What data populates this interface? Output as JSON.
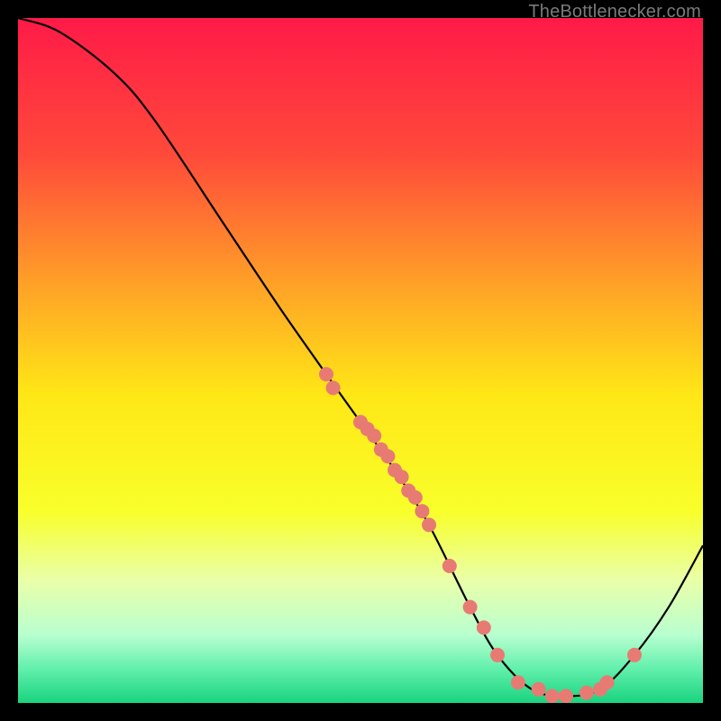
{
  "watermark": "TheBottlenecker.com",
  "chart_data": {
    "type": "line",
    "title": "",
    "xlabel": "",
    "ylabel": "",
    "xlim": [
      0,
      100
    ],
    "ylim": [
      0,
      100
    ],
    "background_gradient": {
      "direction": "vertical",
      "stops": [
        {
          "pos": 0.0,
          "color": "#ff1a48"
        },
        {
          "pos": 0.2,
          "color": "#ff4a3a"
        },
        {
          "pos": 0.4,
          "color": "#ffa626"
        },
        {
          "pos": 0.55,
          "color": "#ffe716"
        },
        {
          "pos": 0.72,
          "color": "#f8ff2a"
        },
        {
          "pos": 0.82,
          "color": "#eaffa8"
        },
        {
          "pos": 0.9,
          "color": "#b9ffd0"
        },
        {
          "pos": 0.95,
          "color": "#62f0ac"
        },
        {
          "pos": 1.0,
          "color": "#19d37f"
        }
      ]
    },
    "curve": [
      {
        "x": 0,
        "y": 100
      },
      {
        "x": 6,
        "y": 98
      },
      {
        "x": 14,
        "y": 92
      },
      {
        "x": 20,
        "y": 85
      },
      {
        "x": 30,
        "y": 70
      },
      {
        "x": 38,
        "y": 58
      },
      {
        "x": 45,
        "y": 48
      },
      {
        "x": 50,
        "y": 41
      },
      {
        "x": 55,
        "y": 34
      },
      {
        "x": 60,
        "y": 26
      },
      {
        "x": 66,
        "y": 14
      },
      {
        "x": 70,
        "y": 7
      },
      {
        "x": 75,
        "y": 2
      },
      {
        "x": 80,
        "y": 1
      },
      {
        "x": 85,
        "y": 2
      },
      {
        "x": 90,
        "y": 7
      },
      {
        "x": 95,
        "y": 14
      },
      {
        "x": 100,
        "y": 23
      }
    ],
    "points": [
      {
        "x": 45,
        "y": 48
      },
      {
        "x": 46,
        "y": 46
      },
      {
        "x": 50,
        "y": 41
      },
      {
        "x": 51,
        "y": 40
      },
      {
        "x": 52,
        "y": 39
      },
      {
        "x": 53,
        "y": 37
      },
      {
        "x": 54,
        "y": 36
      },
      {
        "x": 55,
        "y": 34
      },
      {
        "x": 56,
        "y": 33
      },
      {
        "x": 57,
        "y": 31
      },
      {
        "x": 58,
        "y": 30
      },
      {
        "x": 59,
        "y": 28
      },
      {
        "x": 60,
        "y": 26
      },
      {
        "x": 63,
        "y": 20
      },
      {
        "x": 66,
        "y": 14
      },
      {
        "x": 68,
        "y": 11
      },
      {
        "x": 70,
        "y": 7
      },
      {
        "x": 73,
        "y": 3
      },
      {
        "x": 76,
        "y": 2
      },
      {
        "x": 78,
        "y": 1
      },
      {
        "x": 80,
        "y": 1
      },
      {
        "x": 83,
        "y": 1.5
      },
      {
        "x": 85,
        "y": 2
      },
      {
        "x": 86,
        "y": 3
      },
      {
        "x": 90,
        "y": 7
      }
    ],
    "point_color": "#e77b73",
    "point_radius": 8,
    "curve_color": "#000000",
    "curve_width": 2.2
  }
}
